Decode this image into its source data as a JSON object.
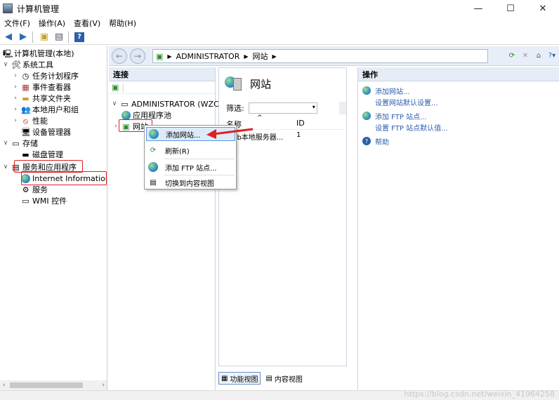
{
  "window": {
    "title": "计算机管理",
    "controls": {
      "minimize": "—",
      "maximize": "☐",
      "close": "✕"
    }
  },
  "menu": [
    "文件(F)",
    "操作(A)",
    "查看(V)",
    "帮助(H)"
  ],
  "tree": {
    "root": "计算机管理(本地)",
    "system_tools": "系统工具",
    "task_scheduler": "任务计划程序",
    "event_viewer": "事件查看器",
    "shared_folders": "共享文件夹",
    "local_users": "本地用户和组",
    "performance": "性能",
    "device_manager": "设备管理器",
    "storage": "存储",
    "disk_management": "磁盘管理",
    "services_apps": "服务和应用程序",
    "iis": "Internet Information S",
    "services": "服务",
    "wmi": "WMI 控件"
  },
  "address": {
    "segments": [
      "ADMINISTRATOR",
      "网站"
    ]
  },
  "connections": {
    "header": "连接",
    "server": "ADMINISTRATOR (WZC\\wz",
    "app_pools": "应用程序池",
    "sites": "网站"
  },
  "content": {
    "title": "网站",
    "filter_label": "筛选:",
    "columns": [
      "名称",
      "ID"
    ],
    "rows": [
      {
        "name": "Web本地服务器...",
        "id": "1"
      }
    ]
  },
  "context_menu": {
    "add_site": "添加网站...",
    "refresh": "刷新(R)",
    "add_ftp": "添加 FTP 站点...",
    "switch_content": "切换到内容视图"
  },
  "actions": {
    "header": "操作",
    "add_site": "添加网站...",
    "site_defaults": "设置网站默认设置...",
    "add_ftp": "添加 FTP 站点...",
    "ftp_defaults": "设置 FTP 站点默认值...",
    "help": "帮助"
  },
  "view_tabs": {
    "features": "功能视图",
    "content": "内容视图"
  },
  "watermark": "https://blog.csdn.net/weixin_41964258",
  "colors": {
    "highlight_red": "#e02020",
    "link_blue": "#2a5db0",
    "pane_header": "#e6ecf5"
  }
}
